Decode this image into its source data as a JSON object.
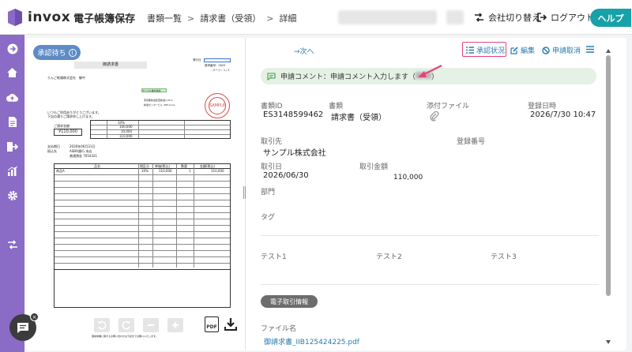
{
  "app": {
    "logo_text": "invox",
    "logo_sub": "電子帳簿保存"
  },
  "breadcrumb": {
    "items": [
      "書類一覧",
      "請求書（受領）",
      "詳細"
    ],
    "sep": ">"
  },
  "header_actions": {
    "switch_company": "会社切り替え",
    "logout": "ログアウト",
    "help": "ヘルプ"
  },
  "status": {
    "label": "承認待ち",
    "info": "i"
  },
  "document": {
    "title": "御請求書",
    "recipient": "りんご乾燥株式会社　御中",
    "intro_1": "いつもご利用ありがとうございます。",
    "intro_2": "下記の通りご請求申し上げます。",
    "amount_label": "ご請求金額",
    "amount": "¥110,000",
    "tax_pct": "10%",
    "tax_rows": [
      "100,000",
      "10,000",
      "110,000"
    ],
    "due_label": "支払期日",
    "due_date": "2026年06月31日",
    "bank_label": "振込先",
    "bank_name": "ASBO銀行 本店",
    "account": "普通預金 7654321",
    "table_headers": [
      "品名",
      "税区分",
      "単価(税込)",
      "数量",
      "金額(税込)"
    ],
    "first_row": [
      "商品A",
      "10%",
      "110,000",
      "1",
      "110,000"
    ],
    "stamp": "SAMPLE",
    "green_tag": "サンプル株式会社",
    "doc_no": "請求番号：0003",
    "page": "ページ：1 / 1",
    "footer_note": "御請求書に関するお問い合わせは下記までお願いいたします。"
  },
  "viewer": {
    "pdf_label": "PDF"
  },
  "detail": {
    "next": "→次へ",
    "actions": {
      "approval": "承認状況",
      "edit": "編集",
      "cancel": "申請取消",
      "menu": "≡"
    },
    "comment": "申請コメント：申請コメント入力します（",
    "comment_end": "）",
    "fields": {
      "doc_id_label": "書類ID",
      "doc_id": "ES3148599462",
      "doc_type_label": "書類",
      "doc_type": "請求書（受領）",
      "attachment_label": "添付ファイル",
      "registered_label": "登録日時",
      "registered": "2026/7/30 10:47",
      "partner_label": "取引先",
      "partner": "サンプル株式会社",
      "reg_no_label": "登録番号",
      "txn_date_label": "取引日",
      "txn_date": "2026/06/30",
      "txn_amount_label": "取引金額",
      "txn_amount": "110,000",
      "dept_label": "部門",
      "tag_label": "タグ",
      "test1": "テスト1",
      "test2": "テスト2",
      "test3": "テスト3"
    },
    "section": "電子取引情報",
    "file_name_label": "ファイル名",
    "file_name": "御請求書_IIB125424225.pdf"
  },
  "colors": {
    "sidebar": "#8a6bc5",
    "help": "#17a1a8",
    "status": "#5e8bc5",
    "highlight": "#e8427c",
    "link": "#2a7ab0",
    "comment_bg": "#e5f1e5"
  }
}
